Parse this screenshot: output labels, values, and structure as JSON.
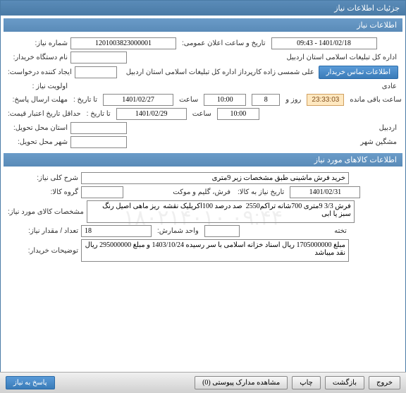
{
  "titlebar": "جزئیات اطلاعات نیاز",
  "section1_header": "اطلاعات نیاز",
  "labels": {
    "niaz_no": "شماره نیاز:",
    "announce_date": "تاریخ و ساعت اعلان عمومی:",
    "buyer_name": "نام دستگاه خریدار:",
    "requester": "ایجاد کننده درخواست:",
    "priority": "اولویت نیاز :",
    "reply_deadline": "مهلت ارسال پاسخ:",
    "to_date": "تا تاریخ :",
    "saat": "ساعت",
    "countdown_suffix": "ساعت باقی مانده",
    "rooz_va": "روز و",
    "price_validity": "حداقل تاریخ اعتبار قیمت:",
    "delivery_province": "استان محل تحویل:",
    "delivery_city": "شهر محل تحویل:"
  },
  "values": {
    "niaz_no": "1201003823000001",
    "announce_date": "1401/02/18 - 09:43",
    "buyer_name": "اداره کل تبلیغات اسلامی استان اردبیل",
    "requester": "علی شمسی زاده کارپرداز اداره کل تبلیغات اسلامی استان اردبیل",
    "priority": "عادی",
    "reply_to_date": "1401/02/27",
    "reply_time": "10:00",
    "days_remaining": "8",
    "countdown": "23:33:03",
    "price_to_date": "1401/02/29",
    "price_time": "10:00",
    "province": "اردبیل",
    "city": "مشگین شهر"
  },
  "buttons": {
    "buyer_contact": "اطلاعات تماس خریدار",
    "reply": "پاسخ به نیاز",
    "attachments": "مشاهده مدارک پیوستی (0)",
    "print": "چاپ",
    "exit": "خروج",
    "prev": "بازگشت"
  },
  "section2_header": "اطلاعات کالاهای مورد نیاز",
  "goods": {
    "labels": {
      "general_desc": "شرح کلی نیاز:",
      "group": "گروه کالا:",
      "need_date": "تاریخ نیاز به کالا:",
      "specs": "مشخصات کالای مورد نیاز:",
      "qty": "تعداد / مقدار نیاز:",
      "unit": "واحد شمارش:",
      "buyer_notes": "توضیحات خریدار:"
    },
    "values": {
      "general_desc": "خرید فرش ماشینی طبق مشخصات زیر 9متری",
      "group": "فرش، گلیم و موکت",
      "need_date": "1401/02/31",
      "specs": "فرش 3/3 9متری 700شانه تراکم2550  صد درصد 100اکریلیک نقشه  ریز ماهی اصیل رنگ سبز یا ابی",
      "qty": "18",
      "unit": "تخته",
      "buyer_notes": "مبلغ 1705000000 ریال اسناد خزانه اسلامی با سر رسیده 1403/10/24 و مبلغ 295000000 ریال نقد میباشد"
    }
  },
  "watermark": "۰۹:۴۴ ۱۸۰۲۱۴۰۱۰"
}
